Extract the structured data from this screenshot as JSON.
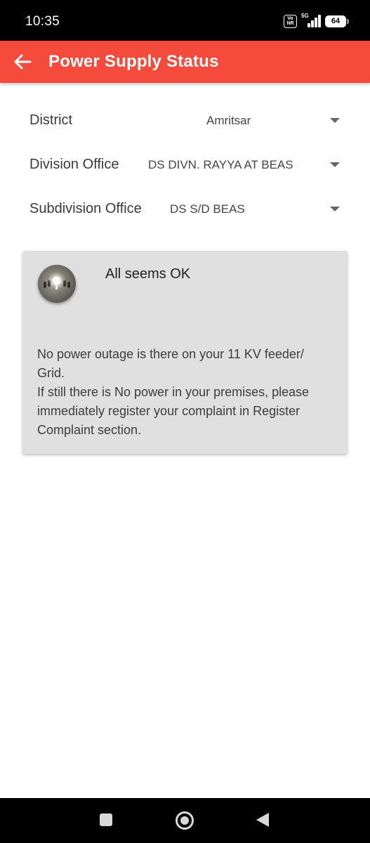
{
  "status_bar": {
    "time": "10:35",
    "volte": "Vo NR",
    "network": "5G",
    "battery": "64"
  },
  "app_bar": {
    "back_icon": "arrow-left-icon",
    "title": "Power Supply Status",
    "color": "#f44b3d"
  },
  "form": {
    "district": {
      "label": "District",
      "value": "Amritsar"
    },
    "division": {
      "label": "Division Office",
      "value": "DS DIVN. RAYYA AT BEAS"
    },
    "subdivision": {
      "label": "Subdivision Office",
      "value": "DS S/D BEAS"
    }
  },
  "status_card": {
    "icon": "light-bulb-icon",
    "title": "All seems OK",
    "message_line1": "No power outage is there on your 11 KV feeder/",
    "message_line2": "Grid.",
    "message_line3": "If still there is No power in your premises, please",
    "message_line4": "immediately register your complaint in Register",
    "message_line5": "Complaint section."
  },
  "nav_bar": {
    "recents_icon": "square-icon",
    "home_icon": "circle-home-icon",
    "back_icon": "triangle-back-icon"
  }
}
